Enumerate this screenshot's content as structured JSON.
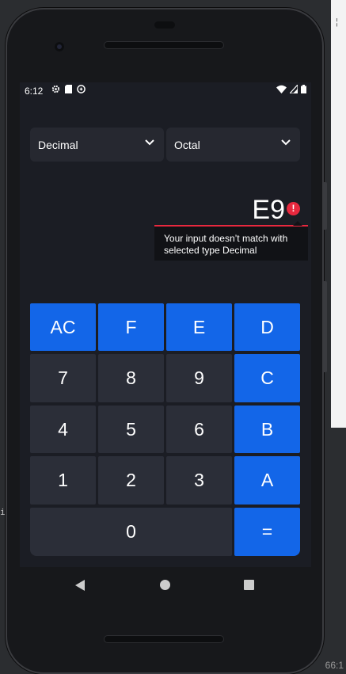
{
  "status_bar": {
    "time": "6:12",
    "left_icons": [
      "gear-icon",
      "sd-card-icon",
      "sync-icon"
    ],
    "right_icons": [
      "wifi-icon",
      "signal-icon",
      "battery-icon"
    ]
  },
  "converter": {
    "from_type": "Decimal",
    "to_type": "Octal",
    "input_value": "E9",
    "error_message": "Your input doesn’t match with selected type  Decimal",
    "error_color": "#e8283e",
    "accent_color": "#1366e8"
  },
  "keypad": {
    "keys": [
      "AC",
      "F",
      "E",
      "D",
      "7",
      "8",
      "9",
      "C",
      "4",
      "5",
      "6",
      "B",
      "1",
      "2",
      "3",
      "A",
      "0",
      "="
    ]
  },
  "ide": {
    "status_text": "66:1"
  }
}
